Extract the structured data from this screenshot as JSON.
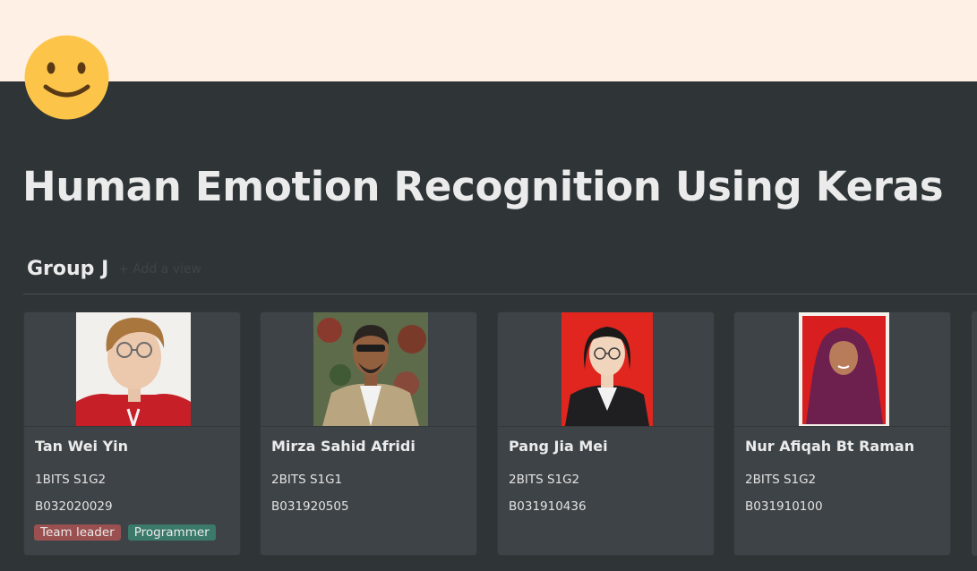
{
  "page": {
    "title": "Human Emotion Recognition Using Keras",
    "icon": "slightly-smiling-face-emoji",
    "cover_color": "#fff0e5"
  },
  "database": {
    "title": "Group J",
    "add_view_label": "+ Add a view"
  },
  "cards": [
    {
      "name": "Tan Wei Yin",
      "class": "1BITS S1G2",
      "id": "B032020029",
      "tags": [
        {
          "label": "Team leader",
          "color": "#9a5050"
        },
        {
          "label": "Programmer",
          "color": "#3b7a6a"
        }
      ],
      "photo_bg": "#f1f0ed"
    },
    {
      "name": "Mirza Sahid Afridi",
      "class": "2BITS S1G1",
      "id": "B031920505",
      "tags": [],
      "photo_bg": "#6f7a5c"
    },
    {
      "name": "Pang Jia Mei",
      "class": "2BITS S1G2",
      "id": "B031910436",
      "tags": [],
      "photo_bg": "#e0261f"
    },
    {
      "name": "Nur Afiqah Bt Raman",
      "class": "2BITS S1G2",
      "id": "B031910100",
      "tags": [],
      "photo_bg": "#d81e1e"
    }
  ]
}
